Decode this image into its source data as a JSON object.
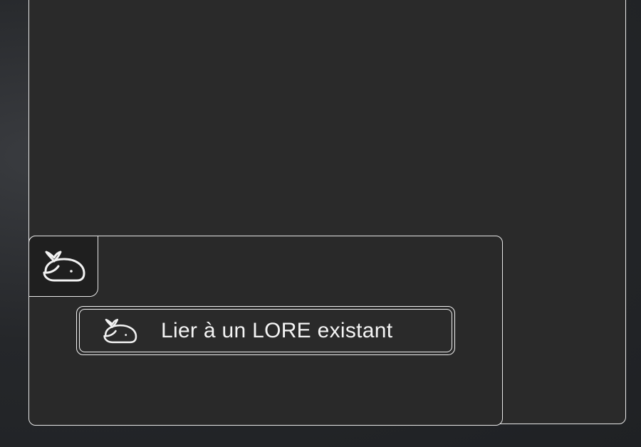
{
  "panel": {
    "icon": "whale-icon"
  },
  "link_button": {
    "label": "Lier à un LORE existant",
    "icon": "whale-icon"
  },
  "colors": {
    "background": "#2a2a2a",
    "border": "#e8e8e8",
    "text": "#f4f4f4"
  }
}
